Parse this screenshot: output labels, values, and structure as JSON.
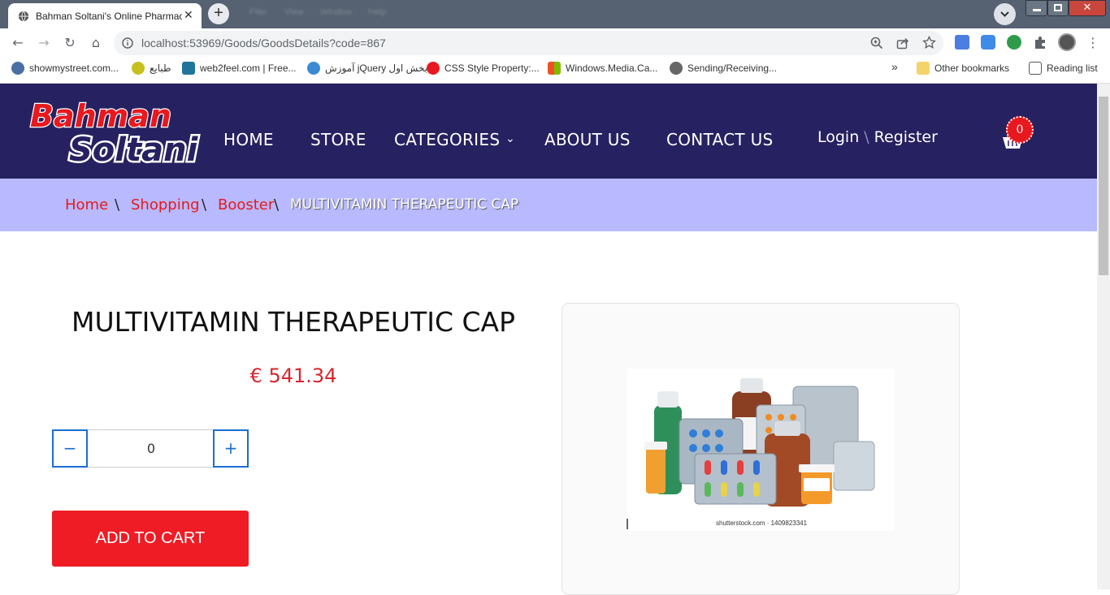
{
  "browser": {
    "tab_title": "Bahman Soltani's Online Pharmacy",
    "blurred_menu": [
      "Filer",
      "View",
      "Window",
      "Help"
    ],
    "url": "localhost:53969/Goods/GoodsDetails?code=867",
    "bookmarks": [
      {
        "label": "showmystreet.com...",
        "color": "#4a6fa5"
      },
      {
        "label": "طبایع",
        "color": "#c8c020"
      },
      {
        "label": "web2feel.com | Free...",
        "color": "#21759b"
      },
      {
        "label": "آموزش jQuery بخش اول",
        "color": "#3a8bd4"
      },
      {
        "label": "CSS Style Property:...",
        "color": "#e8191e"
      },
      {
        "label": "Windows.Media.Ca...",
        "color": "#f25022"
      },
      {
        "label": "Sending/Receiving...",
        "color": "#666666"
      }
    ],
    "overflow": "»",
    "other_bookmarks": "Other bookmarks",
    "reading_list": "Reading list"
  },
  "site": {
    "logo_line1": "Bahman",
    "logo_line2": "Soltani",
    "nav": [
      "HOME",
      "STORE",
      "CATEGORIES",
      "ABOUT US",
      "CONTACT US"
    ],
    "chevron": "⌄",
    "login": "Login",
    "auth_sep": "\\",
    "register": "Register",
    "cart_count": "0",
    "nav_bg": "#262160",
    "accent": "#e8191e"
  },
  "breadcrumb": {
    "items": [
      "Home",
      "Shopping",
      "Booster"
    ],
    "sep": "\\",
    "current": "MULTIVITAMIN THERAPEUTIC CAP"
  },
  "product": {
    "title": "MULTIVITAMIN THERAPEUTIC CAP",
    "price": "€ 541.34",
    "quantity": "0",
    "minus": "−",
    "plus": "+",
    "add_to_cart": "ADD TO CART",
    "image_credit": "shutterstock.com · 1409823341"
  }
}
